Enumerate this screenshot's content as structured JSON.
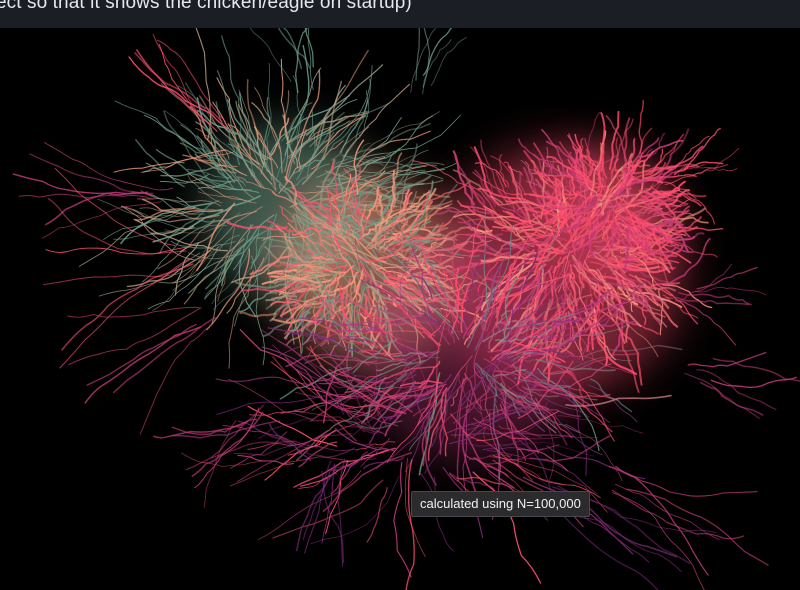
{
  "header": {
    "partial_text": "ect so that it shows the chicken/eagle on startup)"
  },
  "visualization": {
    "name": "hair-flow-visualization",
    "colors": {
      "background": "#000000",
      "teal": "#6c9c88",
      "peach": "#f49a7c",
      "pink": "#ff4f6e",
      "magenta": "#c23a78",
      "purple": "#7e2a78"
    }
  },
  "tooltip": {
    "text": "calculated using N=100,000"
  }
}
